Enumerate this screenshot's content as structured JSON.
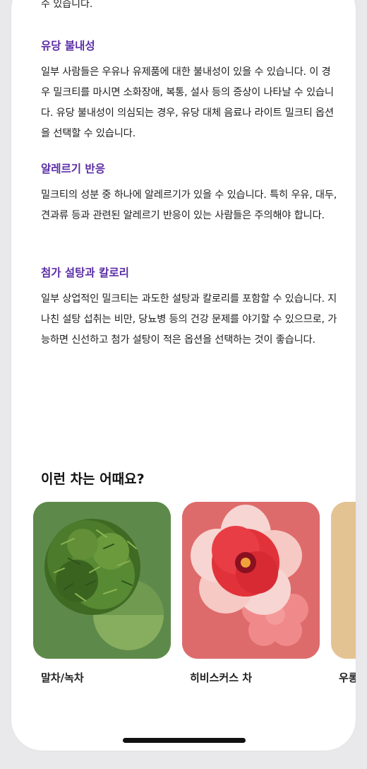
{
  "cut_off_text": "수 있습니다.",
  "sections": [
    {
      "title": "유당 불내성",
      "body": "일부 사람들은 우유나 유제품에 대한 불내성이 있을 수 있습니다. 이 경우 밀크티를 마시면 소화장애, 복통, 설사 등의 증상이 나타날 수 있습니다. 유당 불내성이 의심되는 경우, 유당 대체 음료나 라이트 밀크티 옵션을 선택할 수 있습니다."
    },
    {
      "title": "알레르기 반응",
      "body": "밀크티의 성분 중 하나에 알레르기가 있을 수 있습니다. 특히 우유, 대두, 견과류 등과 관련된 알레르기 반응이 있는 사람들은 주의해야 합니다."
    },
    {
      "title": "첨가 설탕과 칼로리",
      "body": "일부 상업적인 밀크티는 과도한 설탕과 칼로리를 포함할 수 있습니다. 지나친 설탕 섭취는 비만, 당뇨병 등의 건강 문제를 야기할 수 있으므로, 가능하면 신선하고 첨가 설탕이 적은 옵션을 선택하는 것이 좋습니다."
    }
  ],
  "recommendations": {
    "title": "이런 차는 어때요?",
    "cards": [
      {
        "label": "말차/녹차",
        "image_icon": "matcha-leaves-icon",
        "bg_color": "#5d8a4b"
      },
      {
        "label": "히비스커스 차",
        "image_icon": "hibiscus-flower-icon",
        "bg_color": "#de6b6b"
      },
      {
        "label": "우롱",
        "image_icon": "oolong-tea-icon",
        "bg_color": "#e4c393"
      }
    ]
  },
  "colors": {
    "section_title": "#5b2ea6",
    "body_text": "#1f1f1f",
    "background": "#ffffff"
  }
}
